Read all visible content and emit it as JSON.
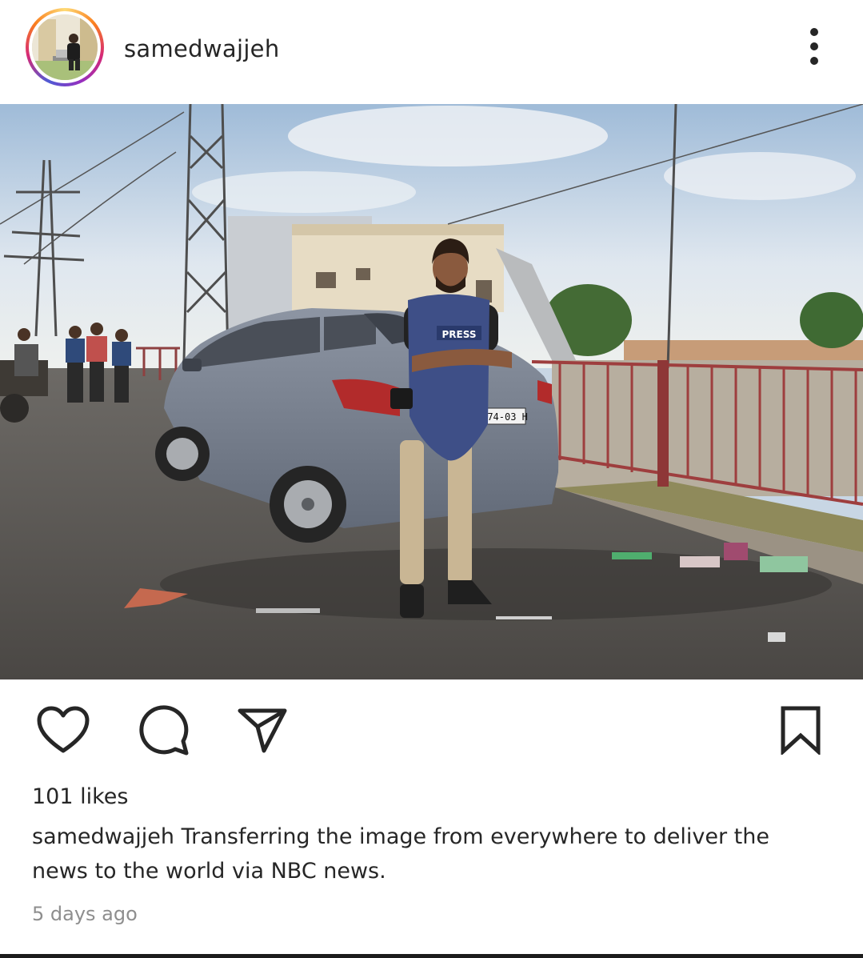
{
  "post": {
    "username": "samedwajjeh",
    "likes_text": "101 likes",
    "caption_username": "samedwajjeh",
    "caption_text": "Transferring the image from everywhere to deliver the news to the world via NBC news.",
    "timestamp": "5 days ago"
  },
  "photo": {
    "vest_label": "PRESS",
    "plate_text": "374-03 H"
  },
  "icons": {
    "more": "more-vertical-icon",
    "like": "heart-icon",
    "comment": "comment-bubble-icon",
    "share": "paper-plane-icon",
    "save": "bookmark-icon"
  },
  "colors": {
    "text": "#262626",
    "muted": "#8e8e8e",
    "ring_start": "#feda75",
    "ring_end": "#d62976"
  }
}
